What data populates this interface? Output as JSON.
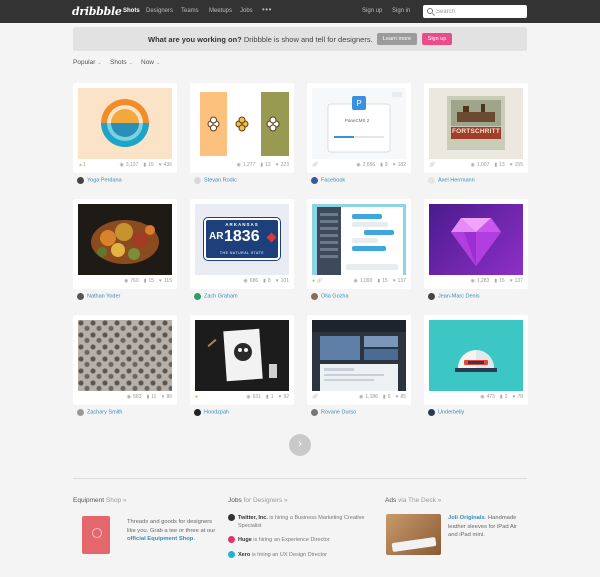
{
  "nav": {
    "logo": "dribbble",
    "links": [
      "Shots",
      "Designers",
      "Teams",
      "Meetups",
      "Jobs"
    ],
    "more": "•••",
    "signup": "Sign up",
    "signin": "Sign in",
    "search_placeholder": "Search"
  },
  "banner": {
    "bold": "What are you working on?",
    "text": " Dribbble is show and tell for designers.",
    "learn_more": "Learn more",
    "signup": "Sign up"
  },
  "filters": [
    "Popular",
    "Shots",
    "Now"
  ],
  "shots": [
    {
      "likes_left": "1",
      "views": "3,137",
      "comments": "15",
      "likes": "436",
      "author": "Yoga Perdana"
    },
    {
      "likes_left": "",
      "views": "1,277",
      "comments": "13",
      "likes": "223",
      "author": "Stevan Rodic"
    },
    {
      "likes_left": "",
      "views": "2,656",
      "comments": "9",
      "likes": "182",
      "author": "Facebook",
      "card_title": "PaneCMS 2"
    },
    {
      "likes_left": "",
      "views": "1,007",
      "comments": "13",
      "likes": "155",
      "author": "Axel Herrmann",
      "poster_text": "FORTSCHRITT"
    },
    {
      "likes_left": "",
      "views": "760",
      "comments": "15",
      "likes": "115",
      "author": "Nathan Yoder"
    },
    {
      "likes_left": "",
      "views": "686",
      "comments": "8",
      "likes": "101",
      "author": "Zach Graham",
      "plate_top": "ARKANSAS",
      "plate_left": "AR",
      "plate_number": "1836",
      "plate_bottom": "THE NATURAL STATE"
    },
    {
      "likes_left": "",
      "views": "1,090",
      "comments": "15",
      "likes": "137",
      "author": "Olia Gozha"
    },
    {
      "likes_left": "",
      "views": "1,283",
      "comments": "16",
      "likes": "137",
      "author": "Jean-Marc Denis"
    },
    {
      "likes_left": "",
      "views": "583",
      "comments": "11",
      "likes": "86",
      "author": "Zachary Smith"
    },
    {
      "likes_left": "",
      "views": "631",
      "comments": "1",
      "likes": "92",
      "author": "Hoodzpah"
    },
    {
      "likes_left": "",
      "views": "1,186",
      "comments": "6",
      "likes": "85",
      "author": "Rovane Durso"
    },
    {
      "likes_left": "",
      "views": "473",
      "comments": "2",
      "likes": "78",
      "author": "Underbelly"
    }
  ],
  "next_label": "›",
  "footer": {
    "equipment_title": "Equipment",
    "equipment_sub": "Shop »",
    "equipment_text": "Threads and goods for designers like you. Grab a tee or three at our",
    "equipment_link": "official Equipment Shop",
    "equipment_end": ".",
    "jobs_title": "Jobs",
    "jobs_sub": "for Designers »",
    "jobs": [
      {
        "company": "Twitter, Inc.",
        "text": " is hiring a Business Marketing Creative",
        "text2": "Specialist",
        "color": "#333333"
      },
      {
        "company": "Huge",
        "text": " is hiring an Experience Director",
        "text2": "",
        "color": "#e2336b"
      },
      {
        "company": "Xero",
        "text": " is hiring an UX Design Director",
        "text2": "",
        "color": "#1ab4d7"
      }
    ],
    "ads_title": "Ads",
    "ads_sub": "via The Deck »",
    "ads_link": "Joli Originals",
    "ads_text": ". Handmade leather sleeves for iPad Air and iPad mini."
  },
  "colors": {
    "brand_pink": "#ea4c89",
    "link": "#3a8bbb",
    "topbar": "#333333"
  }
}
